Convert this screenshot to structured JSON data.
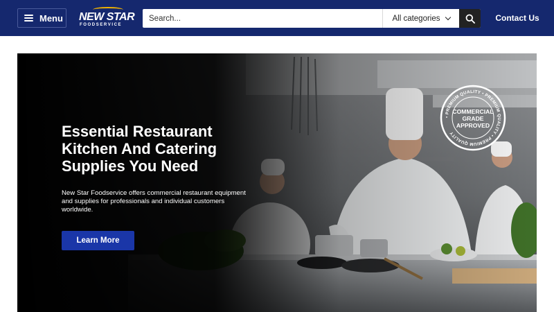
{
  "header": {
    "menu_label": "Menu",
    "logo_line1": "NEW STAR",
    "logo_line2": "FOODSERVICE",
    "search_placeholder": "Search...",
    "category_label": "All categories",
    "contact_label": "Contact Us"
  },
  "hero": {
    "heading_line1": "Essential Restaurant",
    "heading_line2": "Kitchen And Catering",
    "heading_line3": "Supplies You Need",
    "description": "New Star Foodservice offers commercial restaurant equipment and supplies for professionals and individual customers worldwide.",
    "button_label": "Learn More",
    "badge": {
      "ring_text": "• PREMIUM QUALITY • PREMIUM QUALITY • PREMIUM QUALITY ",
      "line1": "COMMERCIAL",
      "line2": "GRADE",
      "line3": "APPROVED"
    }
  },
  "colors": {
    "header_bg": "#15286e",
    "button_bg": "#1a36a8",
    "logo_accent": "#f2b300"
  },
  "icons": [
    "menu-icon",
    "search-icon",
    "chevron-down-icon"
  ]
}
